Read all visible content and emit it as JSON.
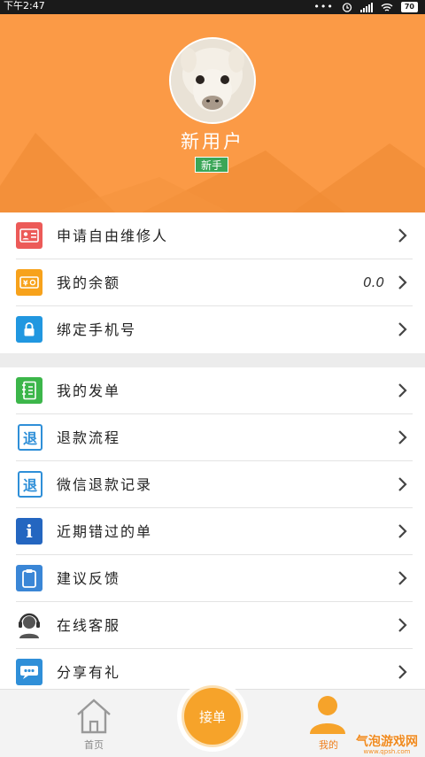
{
  "status_bar": {
    "time": "下午2:47",
    "dots": "•••",
    "battery": "70"
  },
  "profile": {
    "username": "新用户",
    "badge": "新手"
  },
  "menu_group_1": [
    {
      "label": "申请自由维修人",
      "icon": "id-card-icon",
      "color": "#ec5a58",
      "value": ""
    },
    {
      "label": "我的余额",
      "icon": "wallet-icon",
      "color": "#f7a21b",
      "value": "0.0"
    },
    {
      "label": "绑定手机号",
      "icon": "lock-icon",
      "color": "#2197e0",
      "value": ""
    }
  ],
  "menu_group_2": [
    {
      "label": "我的发单",
      "icon": "notebook-icon",
      "color": "#3cb64a",
      "glyph": ""
    },
    {
      "label": "退款流程",
      "icon": "refund-icon",
      "color": "#2f8fd8",
      "glyph": "退"
    },
    {
      "label": "微信退款记录",
      "icon": "refund-record-icon",
      "color": "#2f8fd8",
      "glyph": "退"
    },
    {
      "label": "近期错过的单",
      "icon": "info-icon",
      "color": "#2466c0",
      "glyph": "i"
    },
    {
      "label": "建议反馈",
      "icon": "clipboard-icon",
      "color": "#3a86d6",
      "glyph": ""
    },
    {
      "label": "在线客服",
      "icon": "headset-icon",
      "color": "#555555",
      "glyph": ""
    },
    {
      "label": "分享有礼",
      "icon": "share-icon",
      "color": "#2f8fd8",
      "glyph": ""
    }
  ],
  "tab_bar": {
    "home_label": "首页",
    "center_label": "接单",
    "me_label": "我的"
  },
  "watermark": {
    "text": "气泡游戏网",
    "sub": "www.qpsh.com"
  },
  "colors": {
    "header": "#fb9a46",
    "accent": "#f6a32a",
    "badge": "#3aa657"
  }
}
